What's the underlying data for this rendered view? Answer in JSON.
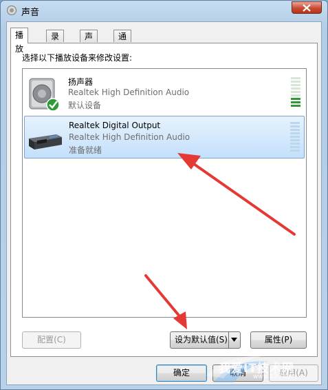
{
  "window": {
    "title": "声音"
  },
  "tabs": [
    "播放",
    "录制",
    "声音",
    "通信"
  ],
  "instruction": "选择以下播放设备来修改设置:",
  "devices": [
    {
      "name": "扬声器",
      "description": "Realtek High Definition Audio",
      "status": "默认设备",
      "icon": "speaker-icon",
      "level": 0.4
    },
    {
      "name": "Realtek Digital Output",
      "description": "Realtek High Definition Audio",
      "status": "准备就绪",
      "icon": "digital-output-icon",
      "level": 0
    }
  ],
  "buttons": {
    "configure": "配置(C)",
    "set_default": "设为默认值(S)",
    "properties": "属性(P)",
    "ok": "确定",
    "cancel": "取消",
    "apply": "应用(A)"
  },
  "watermark": {
    "text": "我爱IT技术网",
    "url": "www.52ij.com"
  },
  "colors": {
    "selection": "#cce4fb",
    "arrow": "#e53935",
    "meter_green": "#2f9a35"
  }
}
